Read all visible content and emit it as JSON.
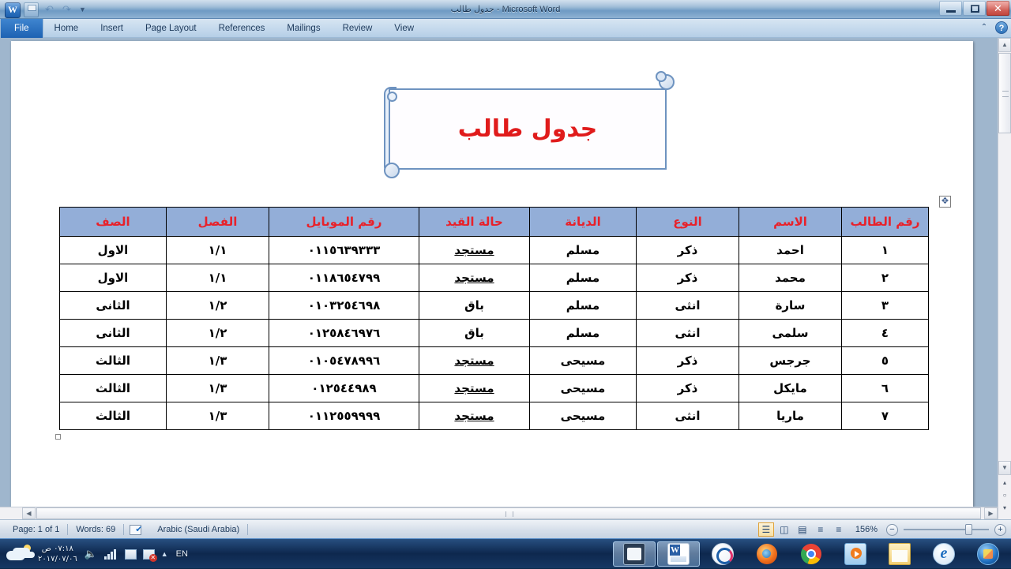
{
  "window": {
    "title": "جدول طالب  -  Microsoft Word",
    "app_icon": "word-icon",
    "quick_access": [
      "save-icon",
      "undo-icon",
      "redo-icon",
      "customize-qat-icon"
    ],
    "controls": {
      "minimize": "–",
      "restore": "❐",
      "close": "✕"
    }
  },
  "ribbon": {
    "tabs": [
      "File",
      "Home",
      "Insert",
      "Page Layout",
      "References",
      "Mailings",
      "Review",
      "View"
    ],
    "minimize_ribbon": "⌃",
    "help": "?"
  },
  "document": {
    "banner_title": "جدول طالب",
    "banner_color": "#e01b1b",
    "table": {
      "header_bg": "#93aed8",
      "header_color": "#e8212a",
      "headers": [
        "رقم الطالب",
        "الاسم",
        "النوع",
        "الديانة",
        "حالة القيد",
        "رقم الموبايل",
        "الفصل",
        "الصف"
      ],
      "rows": [
        {
          "id": "١",
          "name": "احمد",
          "gender": "ذكر",
          "religion": "مسلم",
          "status": "مستجد",
          "phone": "٠١١٥٦٣٩٣٣٣",
          "class": "١/١",
          "grade": "الاول"
        },
        {
          "id": "٢",
          "name": "محمد",
          "gender": "ذكر",
          "religion": "مسلم",
          "status": "مستجد",
          "phone": "٠١١٨٦٥٤٧٩٩",
          "class": "١/١",
          "grade": "الاول"
        },
        {
          "id": "٣",
          "name": "سارة",
          "gender": "انثى",
          "religion": "مسلم",
          "status": "باق",
          "phone": "٠١٠٣٢٥٤٦٩٨",
          "class": "١/٢",
          "grade": "الثانى"
        },
        {
          "id": "٤",
          "name": "سلمى",
          "gender": "انثى",
          "religion": "مسلم",
          "status": "باق",
          "phone": "٠١٢٥٨٤٦٩٧٦",
          "class": "١/٢",
          "grade": "الثانى"
        },
        {
          "id": "٥",
          "name": "جرجس",
          "gender": "ذكر",
          "religion": "مسيحى",
          "status": "مستجد",
          "phone": "٠١٠٥٤٧٨٩٩٦",
          "class": "١/٣",
          "grade": "الثالث"
        },
        {
          "id": "٦",
          "name": "مايكل",
          "gender": "ذكر",
          "religion": "مسيحى",
          "status": "مستجد",
          "phone": "٠١٢٥٤٤٩٨٩",
          "class": "١/٣",
          "grade": "الثالث"
        },
        {
          "id": "٧",
          "name": "ماريا",
          "gender": "انثى",
          "religion": "مسيحى",
          "status": "مستجد",
          "phone": "٠١١٢٥٥٩٩٩٩",
          "class": "١/٣",
          "grade": "الثالث"
        }
      ]
    },
    "table_move_handle": "move-icon"
  },
  "scrollbars": {
    "v_up": "▲",
    "v_down": "▼",
    "browse_prev": "▴",
    "browse_object": "○",
    "browse_next": "▾",
    "h_left": "◀",
    "h_right": "▶"
  },
  "statusbar": {
    "page": "Page: 1 of 1",
    "words": "Words: 69",
    "proofing_icon": "proofing-icon",
    "language": "Arabic (Saudi Arabia)",
    "views": [
      {
        "name": "print-layout-view",
        "glyph": "☰",
        "active": true
      },
      {
        "name": "full-screen-reading-view",
        "glyph": "◫",
        "active": false
      },
      {
        "name": "web-layout-view",
        "glyph": "▤",
        "active": false
      },
      {
        "name": "outline-view",
        "glyph": "≡",
        "active": false
      },
      {
        "name": "draft-view",
        "glyph": "≡",
        "active": false
      }
    ],
    "zoom": "156%",
    "zoom_out": "−",
    "zoom_in": "+"
  },
  "taskbar": {
    "clock_time": "٠٧:١٨ ص",
    "clock_date": "٢٠١٧/٠٧/٠٦",
    "tray": [
      "weather-icon",
      "volume-icon",
      "network-icon",
      "action-center-icon",
      "flag-alert-icon",
      "show-hidden-icons-icon"
    ],
    "language": "EN",
    "apps": [
      {
        "name": "screen-recorder",
        "icon": "recorder-icon",
        "active": true
      },
      {
        "name": "microsoft-word",
        "icon": "word-icon",
        "active": true
      },
      {
        "name": "internet-download-manager",
        "icon": "idm-icon",
        "active": false
      },
      {
        "name": "mozilla-firefox",
        "icon": "firefox-icon",
        "active": false
      },
      {
        "name": "google-chrome",
        "icon": "chrome-icon",
        "active": false
      },
      {
        "name": "media-player",
        "icon": "media-player-icon",
        "active": false
      },
      {
        "name": "windows-explorer",
        "icon": "folder-icon",
        "active": false
      },
      {
        "name": "internet-explorer",
        "icon": "ie-icon",
        "active": false
      },
      {
        "name": "start-button",
        "icon": "start-orb-icon",
        "active": false
      }
    ]
  }
}
